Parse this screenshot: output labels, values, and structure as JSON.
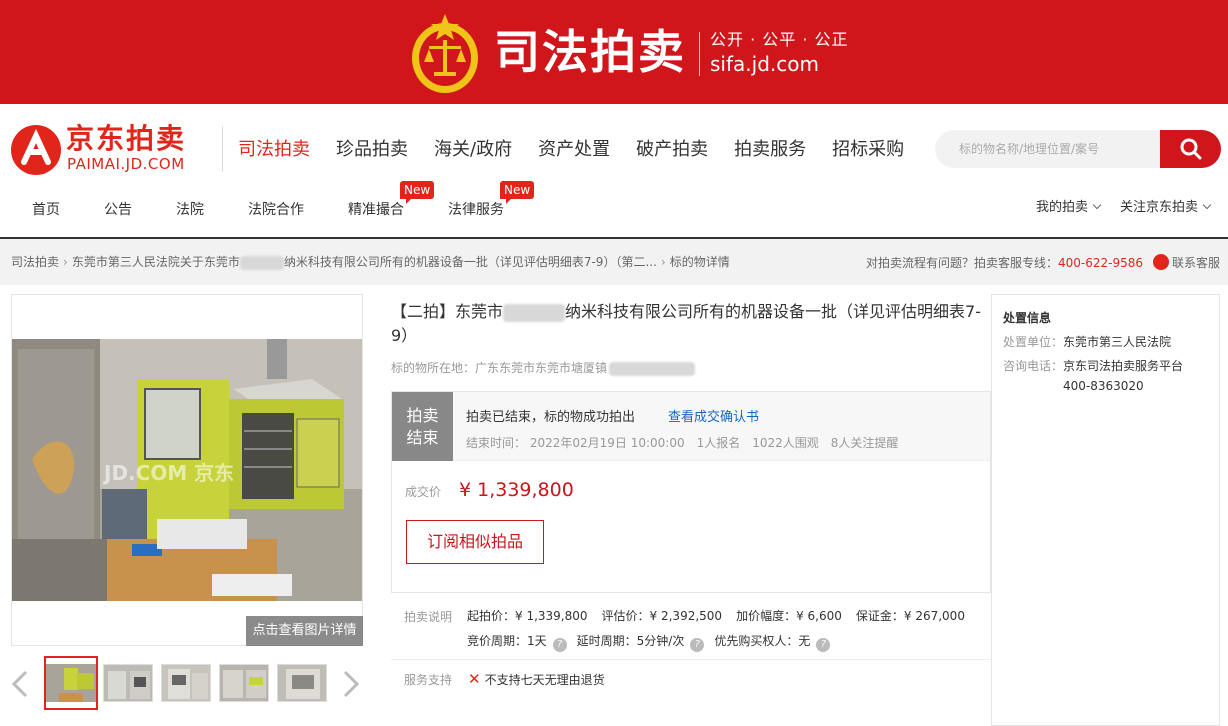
{
  "banner": {
    "title": "司法拍卖",
    "slogan": "公开 · 公平 · 公正",
    "domain": "sifa.jd.com"
  },
  "logo": {
    "name": "京东拍卖",
    "domain": "PAIMAI.JD.COM"
  },
  "main_nav": [
    "司法拍卖",
    "珍品拍卖",
    "海关/政府",
    "资产处置",
    "破产拍卖",
    "拍卖服务",
    "招标采购"
  ],
  "search": {
    "placeholder": "标的物名称/地理位置/案号"
  },
  "sub_nav": {
    "items": [
      "首页",
      "公告",
      "法院",
      "法院合作",
      "精准撮合",
      "法律服务"
    ],
    "badge": "New"
  },
  "user_links": {
    "my_auction": "我的拍卖",
    "follow": "关注京东拍卖"
  },
  "breadcrumb": {
    "root": "司法拍卖",
    "case_prefix": "东莞市第三人民法院关于东莞市",
    "case_suffix": "纳米科技有限公司所有的机器设备一批（详见评估明细表7-9）（第二...",
    "current": "标的物详情"
  },
  "help": {
    "text": "对拍卖流程有问题？拍卖客服专线：",
    "phone": "400-622-9586",
    "service": "联系客服"
  },
  "gallery": {
    "view_details": "点击查看图片详情",
    "watermark": "JD.COM 京东"
  },
  "item": {
    "title_prefix": "【二拍】东莞市",
    "title_suffix": "纳米科技有限公司所有的机器设备一批（详见评估明细表7-9）",
    "location_label": "标的物所在地：",
    "location": "广东东莞市东莞市塘厦镇"
  },
  "status": {
    "tag_line1": "拍卖",
    "tag_line2": "结束",
    "text": "拍卖已结束，标的物成功拍出",
    "link": "查看成交确认书",
    "end_time": "结束时间： 2022年02月19日 10:00:00",
    "signups": "1人报名",
    "watchers": "1022人围观",
    "reminders": "8人关注提醒"
  },
  "deal": {
    "label": "成交价",
    "price": "¥ 1,339,800",
    "subscribe": "订阅相似拍品"
  },
  "terms": {
    "label": "拍卖说明",
    "start_price": "起拍价：¥ 1,339,800",
    "appraisal": "评估价：¥ 2,392,500",
    "increment": "加价幅度：¥ 6,600",
    "deposit": "保证金：¥ 267,000",
    "bid_period": "竞价周期：1天",
    "extension": "延时周期：5分钟/次",
    "priority": "优先购买权人：无"
  },
  "support": {
    "label": "服务支持",
    "text": "不支持七天无理由退货"
  },
  "disposal": {
    "title": "处置信息",
    "unit_label": "处置单位：",
    "unit": "东莞市第三人民法院",
    "phone_label": "咨询电话：",
    "phone_name": "京东司法拍卖服务平台",
    "phone": "400-8363020"
  },
  "colors": {
    "brand_red": "#d1161b",
    "price_red": "#c8161d",
    "link_blue": "#1466c5",
    "status_gray": "#888888"
  }
}
